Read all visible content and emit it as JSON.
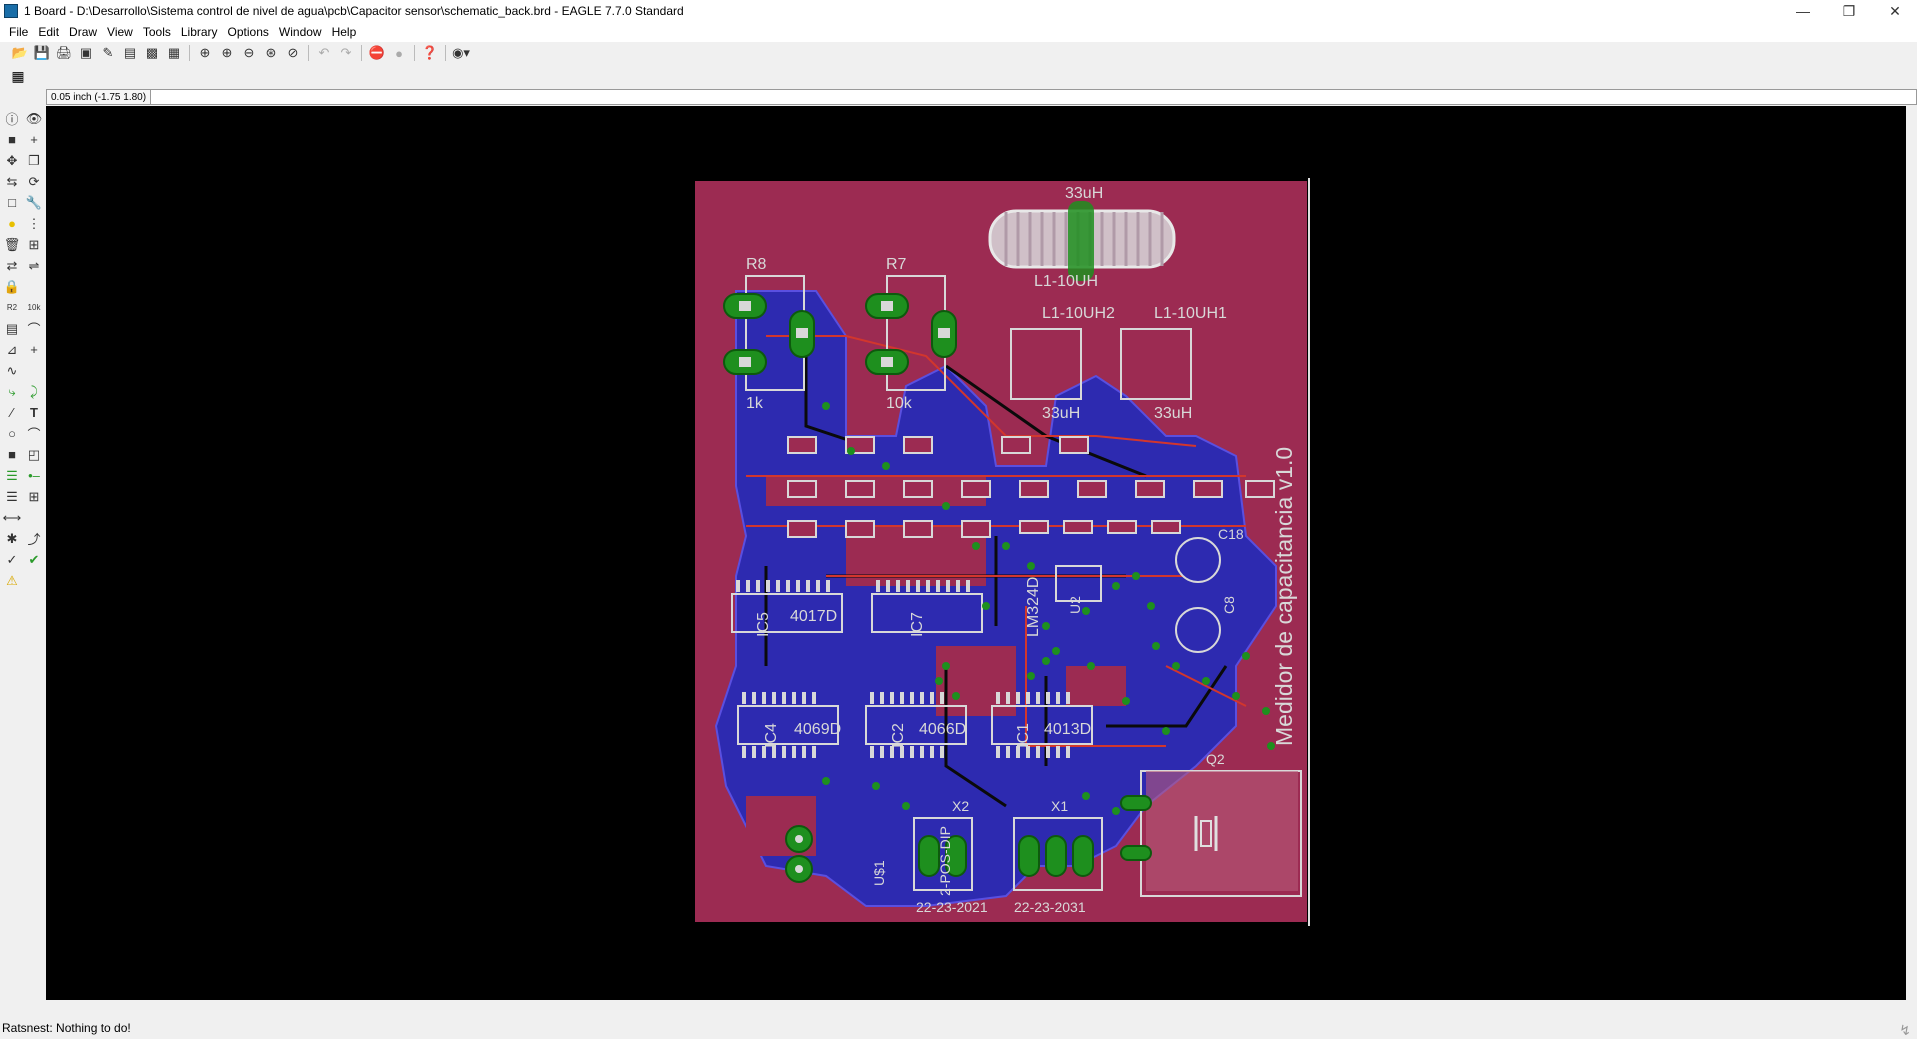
{
  "window": {
    "title": "1 Board - D:\\Desarrollo\\Sistema control de nivel de agua\\pcb\\Capacitor sensor\\schematic_back.brd - EAGLE 7.7.0 Standard",
    "controls": {
      "minimize": "—",
      "restore": "❐",
      "close": "✕"
    }
  },
  "menu": [
    "File",
    "Edit",
    "Draw",
    "View",
    "Tools",
    "Library",
    "Options",
    "Window",
    "Help"
  ],
  "toolbar": {
    "icons": [
      "open-icon",
      "save-icon",
      "print-icon",
      "cam-icon",
      "script-icon",
      "layers-icon",
      "display-icon",
      "palette-icon",
      "zoom-fit-icon",
      "zoom-in-icon",
      "zoom-out-icon",
      "zoom-redraw-icon",
      "zoom-area-icon",
      "undo-icon",
      "redo-icon",
      "stop-icon",
      "go-icon",
      "help-icon",
      "target-icon"
    ]
  },
  "commandbar": {
    "coordinate": "0.05 inch (-1.75 1.80)",
    "command_value": ""
  },
  "status": {
    "text": "Ratsnest: Nothing to do!"
  },
  "board": {
    "colors": {
      "background": "#000000",
      "top_copper": "#9c2b52",
      "bottom_copper": "#2d2ab0",
      "pads": "#1e8f1e",
      "silkscreen": "#d8d8d8"
    },
    "labels": {
      "title_vertical": "Medidor de capacitancia v1.0",
      "r8": "R8",
      "r7": "R7",
      "r8_val": "1k",
      "r7_val": "10k",
      "l_top_val": "33uH",
      "l_top_name": "L1-10UH",
      "l2_name": "L1-10UH2",
      "l1_name": "L1-10UH1",
      "l2_val": "33uH",
      "l1_val": "33uH",
      "ic5": "IC5",
      "ic5_val": "4017D",
      "ic7": "IC7",
      "ic7_val": "LM324D",
      "ic4": "IC4",
      "ic4_val": "4069D",
      "ic2": "IC2",
      "ic2_val": "4066D",
      "ic1": "IC1",
      "ic1_val": "4013D",
      "c18": "C18",
      "c8": "C8",
      "q2": "Q2",
      "u2": "U2",
      "x2": "X2",
      "x1": "X1",
      "x2_val": "22-23-2021",
      "x1_val": "22-23-2031",
      "us1": "U$1",
      "dip": "2-POS-DIP"
    }
  }
}
